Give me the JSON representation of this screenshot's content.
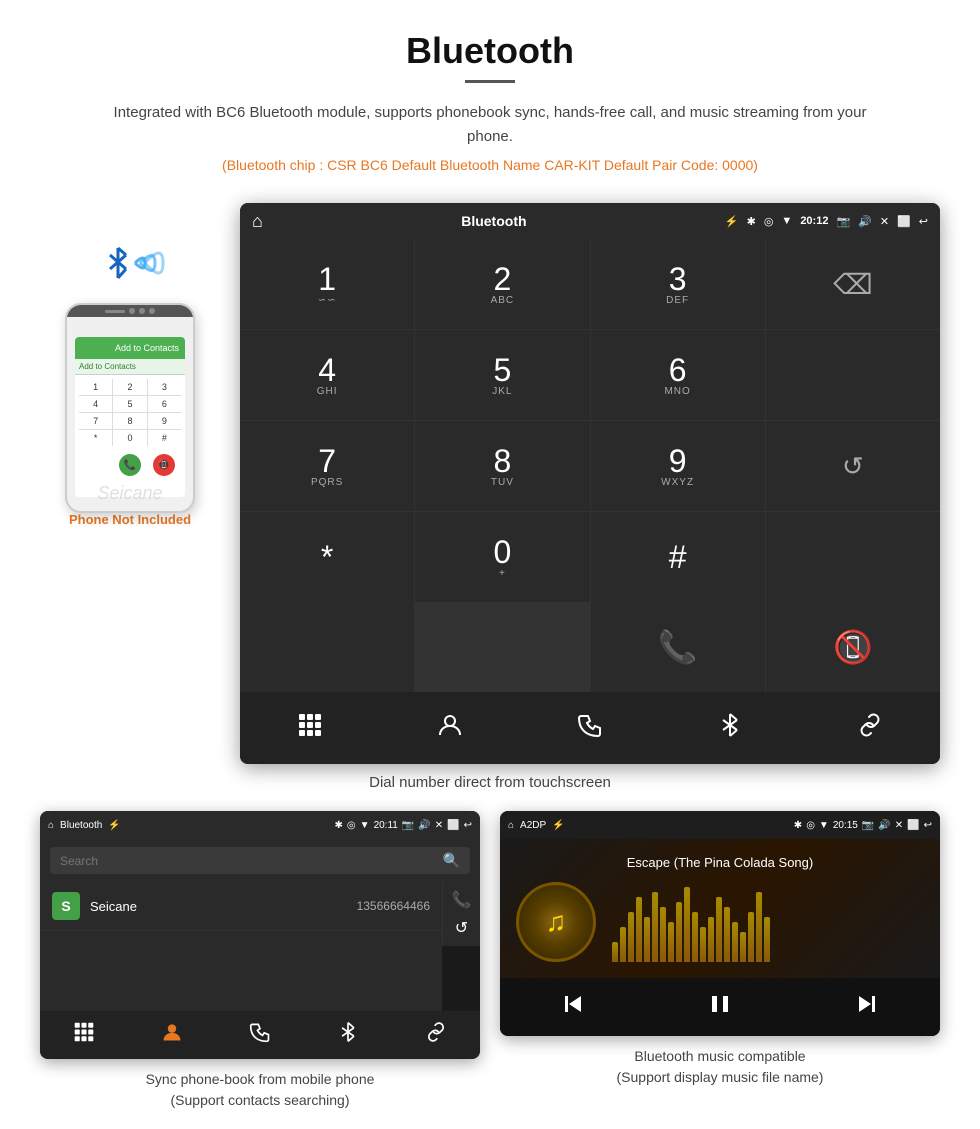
{
  "header": {
    "title": "Bluetooth",
    "description": "Integrated with BC6 Bluetooth module, supports phonebook sync, hands-free call, and music streaming from your phone.",
    "specs": "(Bluetooth chip : CSR BC6    Default Bluetooth Name CAR-KIT    Default Pair Code: 0000)"
  },
  "phone_mockup": {
    "not_included_label": "Phone Not Included",
    "watermark": "Seicane",
    "screen_label": "Add to Contacts",
    "dial_digits": [
      "1",
      "2",
      "3",
      "4",
      "5",
      "6",
      "7",
      "8",
      "9",
      "*",
      "0",
      "#"
    ]
  },
  "dial_screen": {
    "status": {
      "left_icon_home": "⌂",
      "title": "Bluetooth",
      "usb_icon": "⚡",
      "bluetooth": "✱",
      "location": "◎",
      "signal": "▼",
      "time": "20:12",
      "camera": "📷",
      "volume": "🔊",
      "x_icon": "✕",
      "window": "⬜",
      "back": "↩"
    },
    "keys": [
      {
        "num": "1",
        "sub": "∽∽"
      },
      {
        "num": "2",
        "sub": "ABC"
      },
      {
        "num": "3",
        "sub": "DEF"
      },
      {
        "num": "",
        "sub": "",
        "action": "backspace"
      },
      {
        "num": "4",
        "sub": "GHI"
      },
      {
        "num": "5",
        "sub": "JKL"
      },
      {
        "num": "6",
        "sub": "MNO"
      },
      {
        "num": "",
        "sub": "",
        "action": "empty"
      },
      {
        "num": "7",
        "sub": "PQRS"
      },
      {
        "num": "8",
        "sub": "TUV"
      },
      {
        "num": "9",
        "sub": "WXYZ"
      },
      {
        "num": "",
        "sub": "",
        "action": "reload"
      },
      {
        "num": "*",
        "sub": ""
      },
      {
        "num": "0",
        "sub": "+"
      },
      {
        "num": "#",
        "sub": ""
      },
      {
        "num": "",
        "sub": "",
        "action": "call_green"
      },
      {
        "num": "",
        "sub": "",
        "action": "call_red"
      }
    ],
    "toolbar": {
      "items": [
        "dialpad",
        "contacts",
        "phone",
        "bluetooth",
        "link"
      ]
    }
  },
  "caption_main": "Dial number direct from touchscreen",
  "phonebook_screen": {
    "status": {
      "left": "⌂  Bluetooth  ⚡",
      "right": "✱ ◎ ▼  20:11  📷  🔊  ✕  ⬜  ↩"
    },
    "search_placeholder": "Search",
    "contact": {
      "letter": "S",
      "name": "Seicane",
      "number": "13566664466"
    },
    "toolbar_items": [
      "dialpad",
      "person_orange",
      "phone",
      "bluetooth",
      "link"
    ]
  },
  "phonebook_caption": {
    "line1": "Sync phone-book from mobile phone",
    "line2": "(Support contacts searching)"
  },
  "music_screen": {
    "status": {
      "left": "⌂  A2DP  ⚡",
      "right": "✱ ◎ ▼  20:15  📷  🔊  ✕  ⬜  ↩"
    },
    "song_title": "Escape (The Pina Colada Song)",
    "controls": [
      "prev",
      "play_pause",
      "next"
    ],
    "bars_heights": [
      20,
      35,
      50,
      65,
      45,
      70,
      55,
      40,
      60,
      75,
      50,
      35,
      45,
      65,
      55,
      40,
      30,
      50,
      70,
      45
    ]
  },
  "music_caption": {
    "line1": "Bluetooth music compatible",
    "line2": "(Support display music file name)"
  },
  "colors": {
    "orange": "#e87722",
    "green": "#43a047",
    "red": "#e53935",
    "screen_bg": "#1a1a1a",
    "status_bg": "#2a2a2a"
  }
}
